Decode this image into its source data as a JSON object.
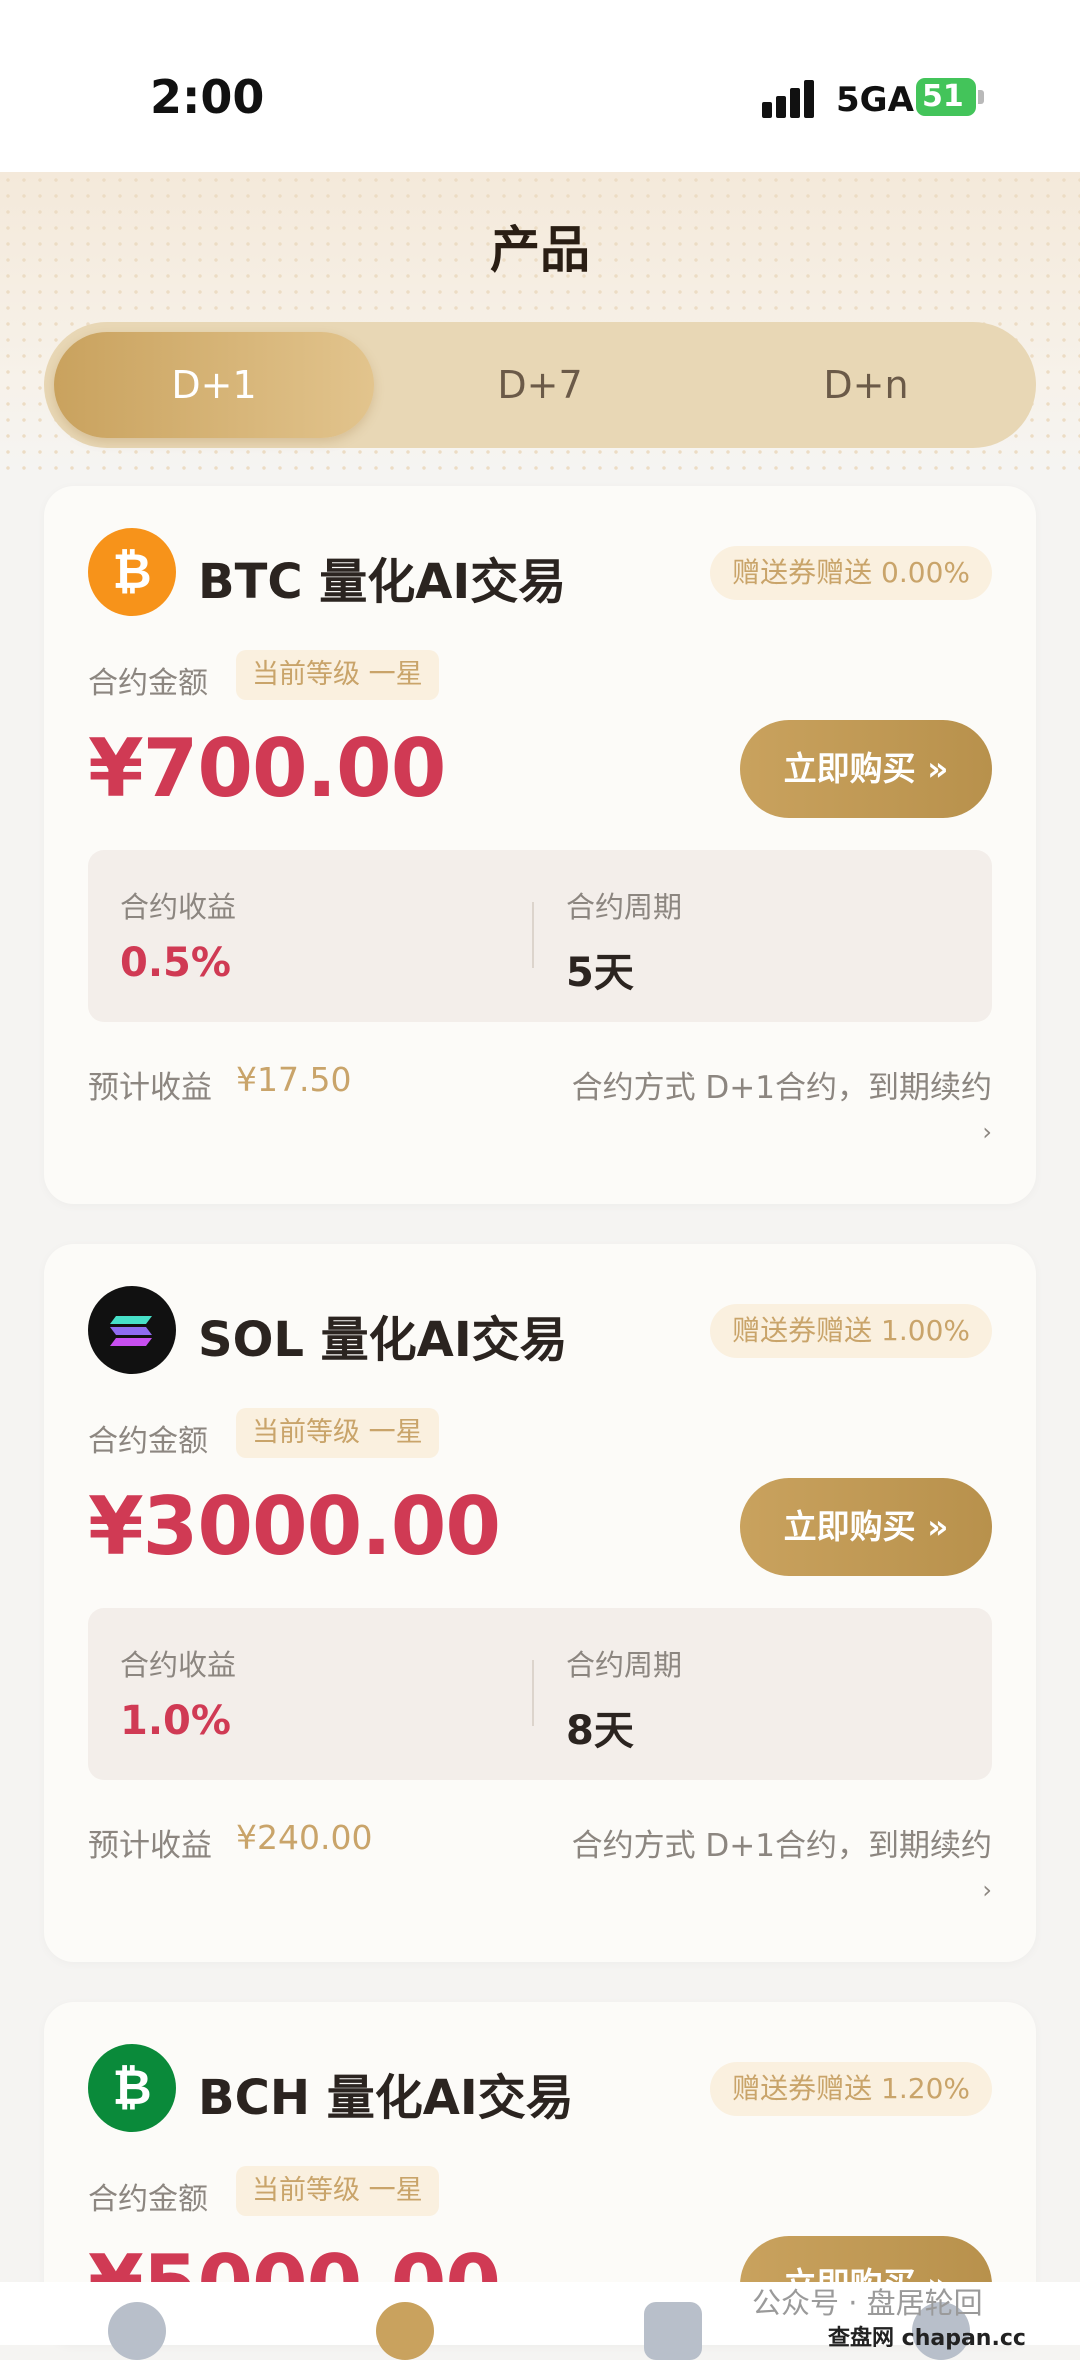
{
  "status_bar": {
    "time": "2:00",
    "network": "5GA",
    "battery": "51"
  },
  "header": {
    "title": "产品"
  },
  "tabs": [
    {
      "label": "D+1",
      "active": true
    },
    {
      "label": "D+7",
      "active": false
    },
    {
      "label": "D+n",
      "active": false
    }
  ],
  "products": [
    {
      "coin": "BTC",
      "icon": "bitcoin-icon",
      "coin_color": "#f7931a",
      "glyph": "₿",
      "title": "BTC 量化AI交易",
      "coupon": "赠送券赠送 0.00%",
      "amount_label": "合约金额",
      "level": "当前等级 一星",
      "price": "¥700.00",
      "buy_label": "立即购买 »",
      "yield_label": "合约收益",
      "yield": "0.5%",
      "period_label": "合约周期",
      "period": "5天",
      "est_label": "预计收益",
      "est": "¥17.50",
      "method": "合约方式  D+1合约，到期续约",
      "chevron": "›"
    },
    {
      "coin": "SOL",
      "icon": "solana-icon",
      "coin_color": "#111111",
      "glyph": "≡",
      "title": "SOL 量化AI交易",
      "coupon": "赠送券赠送 1.00%",
      "amount_label": "合约金额",
      "level": "当前等级 一星",
      "price": "¥3000.00",
      "buy_label": "立即购买 »",
      "yield_label": "合约收益",
      "yield": "1.0%",
      "period_label": "合约周期",
      "period": "8天",
      "est_label": "预计收益",
      "est": "¥240.00",
      "method": "合约方式  D+1合约，到期续约",
      "chevron": "›"
    },
    {
      "coin": "BCH",
      "icon": "bitcoin-cash-icon",
      "coin_color": "#0a8a3a",
      "glyph": "₿",
      "title": "BCH 量化AI交易",
      "coupon": "赠送券赠送 1.20%",
      "amount_label": "合约金额",
      "level": "当前等级 一星",
      "price": "¥5000.00",
      "buy_label": "立即购买 »"
    }
  ],
  "watermark": {
    "text": "公众号 · 盘居轮回",
    "site": "查盘网 chapan.cc"
  },
  "colors": {
    "accent_gold": "#c9a25e",
    "price_red": "#d03a54",
    "tab_track": "#e8d7b5"
  }
}
